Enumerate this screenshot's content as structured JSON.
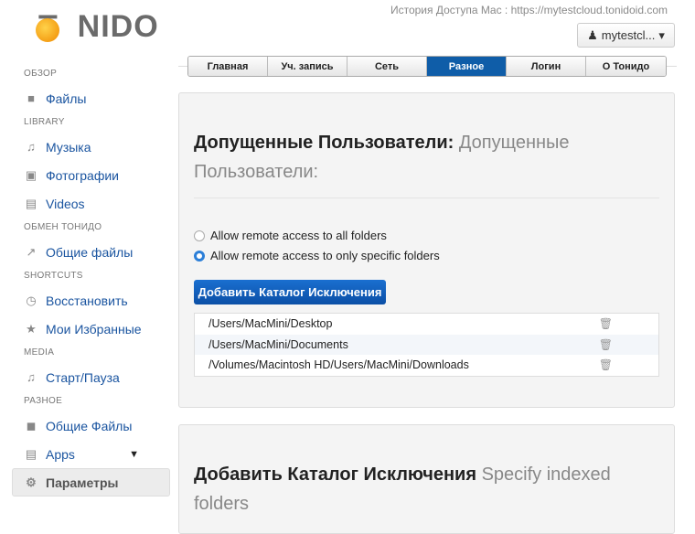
{
  "header": {
    "logo_text": "TONIDO",
    "history": "История Доступа Mac : https://mytestcloud.tonidoid.com",
    "user": "mytestcl..."
  },
  "tabs": [
    {
      "label": "Главная"
    },
    {
      "label": "Уч. запись"
    },
    {
      "label": "Сеть"
    },
    {
      "label": "Разное",
      "active": true
    },
    {
      "label": "Логин"
    },
    {
      "label": "О Тонидо"
    }
  ],
  "sidebar": {
    "s1": "ОБЗОР",
    "files": "Файлы",
    "s2": "LIBRARY",
    "music": "Музыка",
    "photos": "Фотографии",
    "videos": "Videos",
    "s3": "ОБМЕН ТОНИДО",
    "shared": "Общие файлы",
    "s4": "SHORTCUTS",
    "restore": "Восстановить",
    "favorites": "Мои Избранные",
    "s5": "MEDIA",
    "play": "Старт/Пауза",
    "s6": "РАЗНОЕ",
    "shared2": "Общие Файлы",
    "apps": "Apps",
    "settings": "Параметры"
  },
  "panel1": {
    "title_bold": "Допущенные Пользователи:",
    "title_sub": "Допущенные",
    "title_line2": "Пользователи:",
    "radio_all": "Allow remote access to all folders",
    "radio_specific": "Allow remote access to only specific folders",
    "add_button": "Добавить Каталог Исключения",
    "folders": [
      "/Users/MacMini/Desktop",
      "/Users/MacMini/Documents",
      "/Volumes/Macintosh HD/Users/MacMini/Downloads"
    ]
  },
  "panel2": {
    "title_bold": "Добавить Каталог Исключения",
    "title_sub": "Specify indexed",
    "title_line2": "folders"
  }
}
